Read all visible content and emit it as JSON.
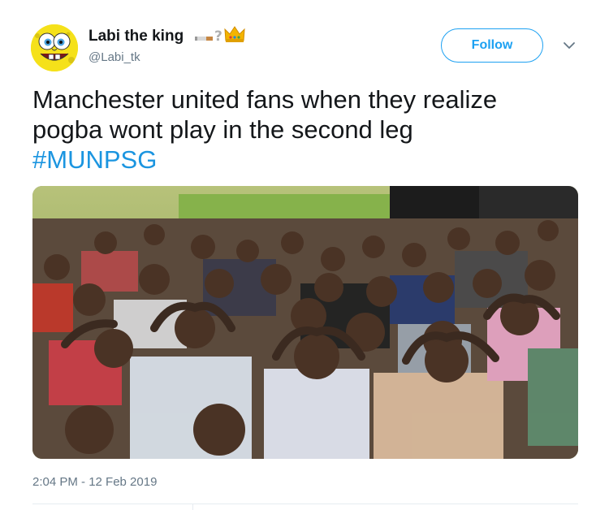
{
  "author": {
    "display_name": "Labi the king",
    "handle": "@Labi_tk",
    "avatar_icon": "spongebob-avatar-icon",
    "name_emojis": [
      "cigarette-icon",
      "question-mark-icon",
      "crown-icon"
    ]
  },
  "follow_button": {
    "label": "Follow"
  },
  "more_menu": {
    "icon": "chevron-down-icon"
  },
  "tweet": {
    "line1": "Manchester united fans when they realize",
    "line2": "pogba wont play in the second leg",
    "hashtag": "#MUNPSG"
  },
  "media": {
    "type": "photo"
  },
  "meta": {
    "timestamp": "2:04 PM - 12 Feb 2019"
  },
  "colors": {
    "accent": "#1da1f2",
    "hashtag": "#1b95e0",
    "secondary_text": "#657786",
    "primary_text": "#14171a"
  }
}
